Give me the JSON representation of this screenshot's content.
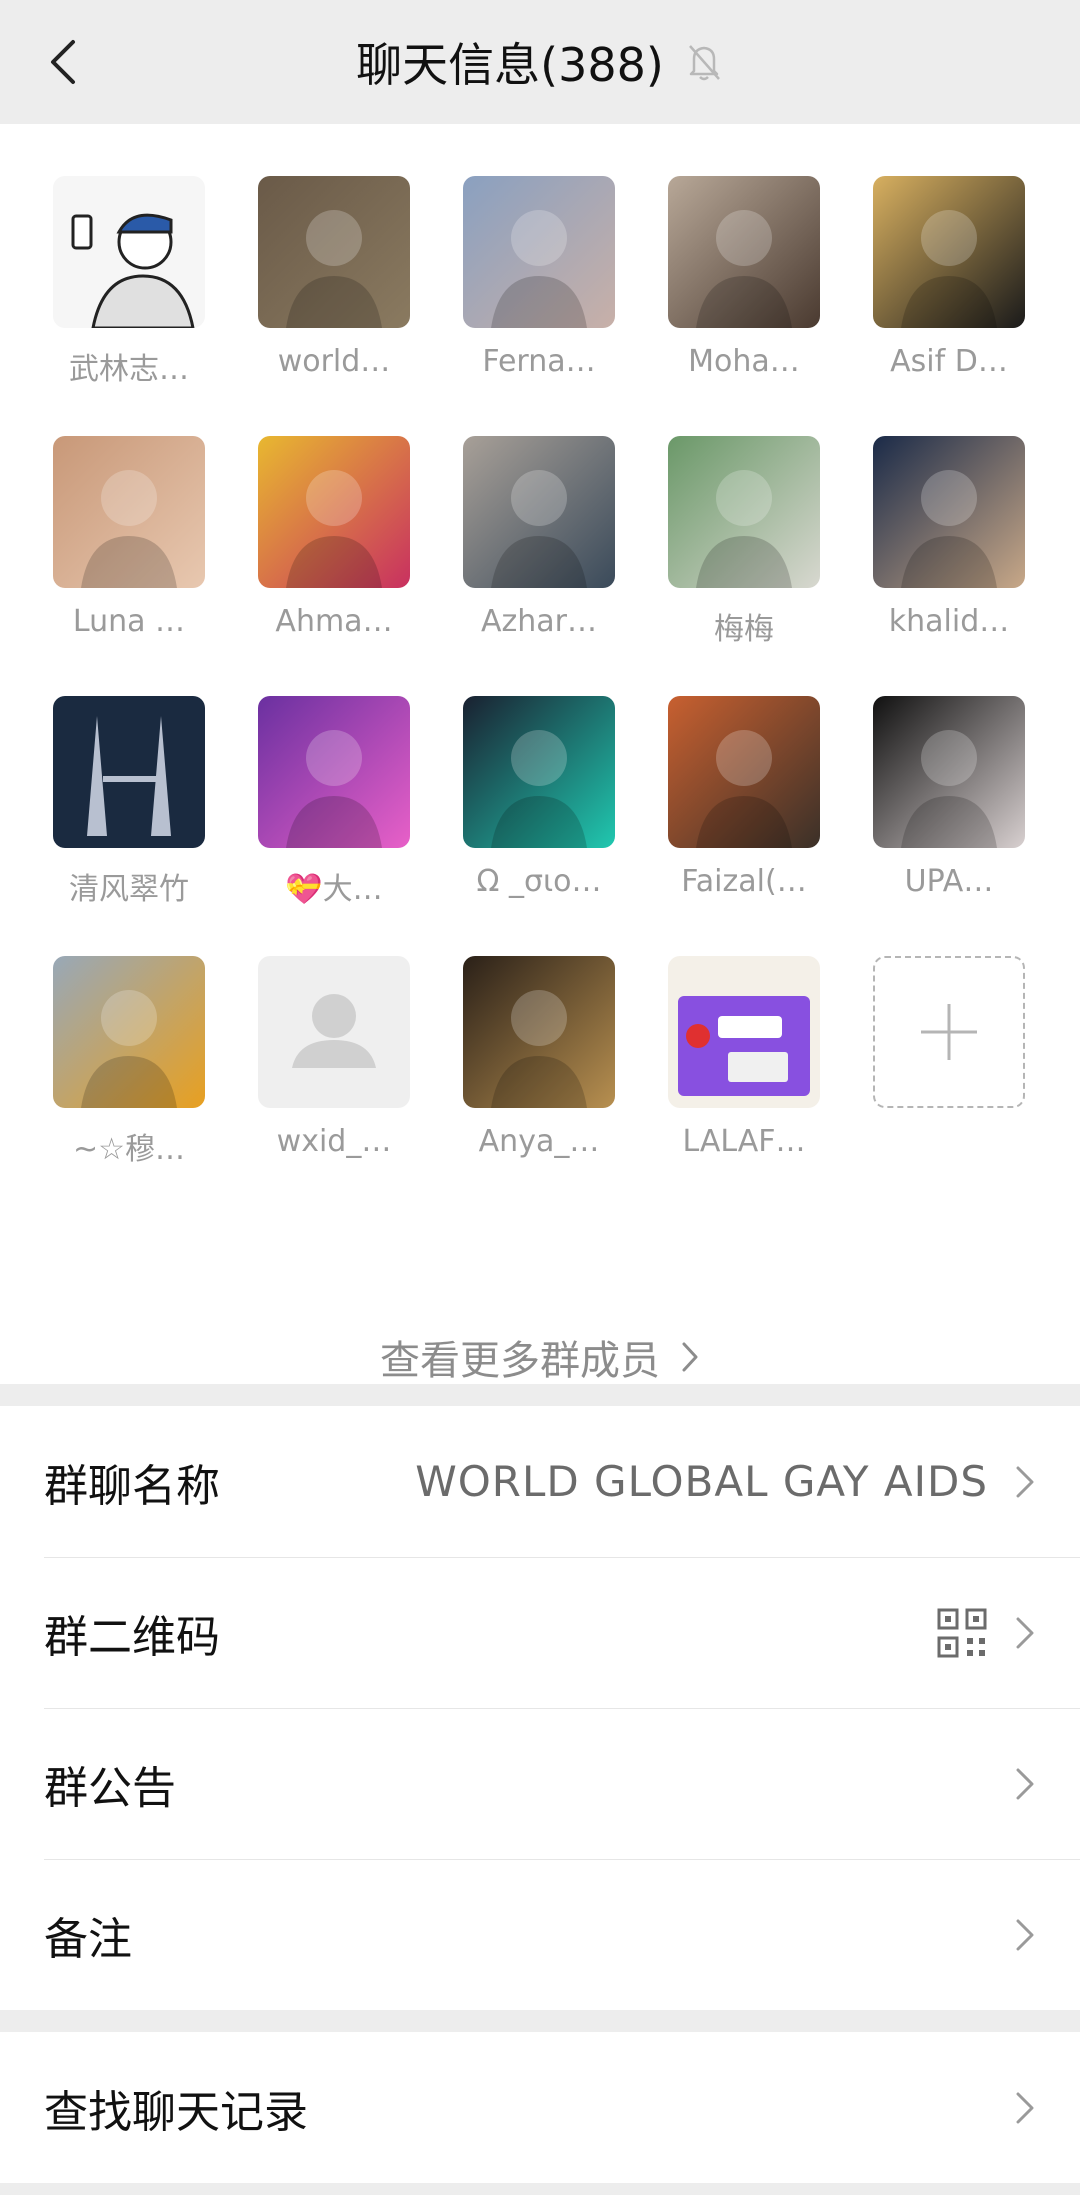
{
  "header": {
    "title": "聊天信息(388)",
    "back_icon": "chevron-left-icon",
    "mute_icon": "bell-off-icon"
  },
  "members": [
    {
      "name": "武林志…",
      "avatar": "cartoon-selfie"
    },
    {
      "name": "world…",
      "avatar": "photo"
    },
    {
      "name": "Ferna…",
      "avatar": "photo"
    },
    {
      "name": "Moha…",
      "avatar": "photo"
    },
    {
      "name": "Asif D…",
      "avatar": "photo"
    },
    {
      "name": "Luna …",
      "avatar": "photo"
    },
    {
      "name": "Ahma…",
      "avatar": "photo"
    },
    {
      "name": "Azhar…",
      "avatar": "photo"
    },
    {
      "name": "梅梅",
      "avatar": "photo"
    },
    {
      "name": "khalid…",
      "avatar": "photo"
    },
    {
      "name": "清风翠竹",
      "avatar": "towers"
    },
    {
      "name": "💝大…",
      "avatar": "photo"
    },
    {
      "name": "Ω _σιο…",
      "avatar": "photo"
    },
    {
      "name": "Faizal(…",
      "avatar": "photo"
    },
    {
      "name": "UPA…",
      "avatar": "photo"
    },
    {
      "name": "~☆穆…",
      "avatar": "photo"
    },
    {
      "name": "wxid_…",
      "avatar": "default-user"
    },
    {
      "name": "Anya_…",
      "avatar": "photo"
    },
    {
      "name": "LALAF…",
      "avatar": "poster"
    }
  ],
  "more_members": "查看更多群成员",
  "settings": {
    "group_name_label": "群聊名称",
    "group_name_value": "WORLD GLOBAL GAY AIDS",
    "qr_label": "群二维码",
    "notice_label": "群公告",
    "remark_label": "备注"
  },
  "search": {
    "label": "查找聊天记录"
  },
  "colors": {
    "background": "#ededed",
    "card": "#ffffff",
    "secondary_text": "#9a9a9a"
  }
}
